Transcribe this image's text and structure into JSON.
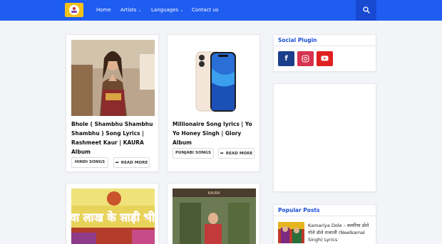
{
  "nav": {
    "items": [
      {
        "label": "Home",
        "has_caret": false
      },
      {
        "label": "Artists",
        "has_caret": true
      },
      {
        "label": "Languages",
        "has_caret": true
      },
      {
        "label": "Contact us",
        "has_caret": false
      }
    ],
    "caret": "⌄"
  },
  "posts": [
    {
      "title": "Bhole ( Shambhu Shambhu Shambhu ) Song Lyrics | Rashmeet Kaur | KAURA Album",
      "tag": "HINDI SONGS",
      "read_more": "READ MORE"
    },
    {
      "title": "Millionaire Song lyrics | Yo Yo Honey Singh | Glory Album",
      "tag": "PUNJABI SONGS",
      "read_more": "READ MORE"
    },
    {
      "image_text": "सवा लाख के साड़ी भीजे"
    },
    {
      "image_text": "KAURA"
    }
  ],
  "sidebar": {
    "social_title": "Social Plugin",
    "social_icons": [
      "facebook-icon",
      "instagram-icon",
      "youtube-icon"
    ],
    "popular_title": "Popular Posts",
    "popular_post": "Kamariya Dole – कमरिया डोले गोले डोले राजाजी (Neelkamal Singh) Lyrics"
  },
  "colors": {
    "header": "#1f5cf0",
    "accent_text": "#1a4fd8",
    "facebook": "#1b3e8c",
    "instagram": "#d6334f",
    "youtube": "#e02020"
  }
}
